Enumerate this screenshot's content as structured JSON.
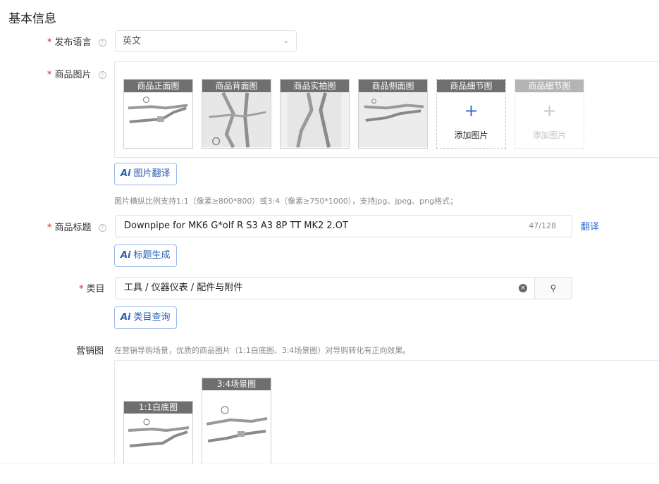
{
  "section": {
    "title": "基本信息"
  },
  "language": {
    "label": "发布语言",
    "value": "英文"
  },
  "images": {
    "label": "商品图片",
    "slots": [
      {
        "caption": "商品正面图"
      },
      {
        "caption": "商品背面图"
      },
      {
        "caption": "商品实拍图"
      },
      {
        "caption": "商品侧面图"
      },
      {
        "caption": "商品细节图",
        "add_text": "添加图片"
      },
      {
        "caption": "商品细节图",
        "add_text": "添加图片"
      }
    ],
    "translate_button": "图片翻译",
    "hint": "图片横纵比例支持1:1（像素≥800*800）或3:4（像素≥750*1000），支持jpg、jpeg、png格式；"
  },
  "title": {
    "label": "商品标题",
    "value": "Downpipe for MK6 G*olf R S3 A3  8P TT  MK2 2.OT",
    "count": "47/128",
    "translate_link": "翻译",
    "generate_button": "标题生成"
  },
  "category": {
    "label": "类目",
    "value": "工具 / 仪器仪表 / 配件与附件",
    "query_button": "类目查询"
  },
  "marketing": {
    "label": "营销图",
    "hint": "在营销导购场景，优质的商品图片（1:1白底图、3:4场景图）对导购转化有正向效果。",
    "images": [
      {
        "caption": "1:1白底图"
      },
      {
        "caption": "3:4场景图"
      }
    ]
  },
  "ai_mark": "Ai",
  "required_mark": "*",
  "help_mark": "?",
  "icons": {
    "select_arrow": "chevron-down-icon",
    "clear": "clear-icon",
    "search": "search-icon",
    "add": "plus-icon"
  },
  "colors": {
    "required": "#e0261c",
    "accent": "#2a5db0",
    "link": "#2a6ed6",
    "caption_bg": "#6f6f6f"
  }
}
